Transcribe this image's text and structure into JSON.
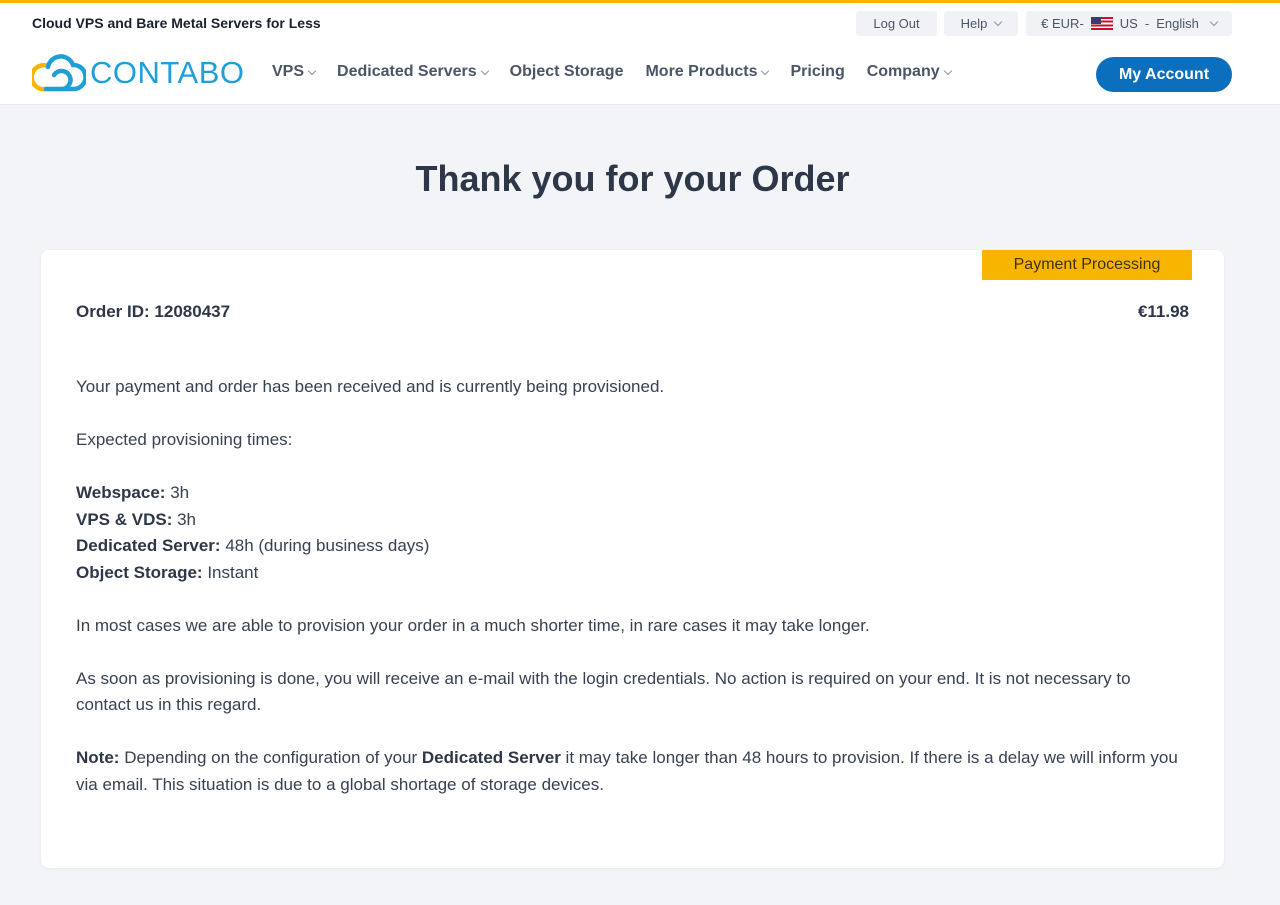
{
  "header": {
    "tagline": "Cloud VPS and Bare Metal Servers for Less",
    "logout": "Log Out",
    "help": "Help",
    "currency": "€ EUR-",
    "country": "US",
    "locale_sep": "-",
    "language": "English",
    "logo_text": "CONTABO",
    "my_account": "My Account",
    "accent_color": "#0c6fbe",
    "brand_color": "#1e9fd8",
    "highlight_color": "#f7b500"
  },
  "nav": {
    "items": [
      {
        "label": "VPS",
        "dropdown": true
      },
      {
        "label": "Dedicated Servers",
        "dropdown": true
      },
      {
        "label": "Object Storage",
        "dropdown": false
      },
      {
        "label": "More Products",
        "dropdown": true
      },
      {
        "label": "Pricing",
        "dropdown": false
      },
      {
        "label": "Company",
        "dropdown": true
      }
    ]
  },
  "page": {
    "title": "Thank you for your Order"
  },
  "order": {
    "status": "Payment Processing",
    "id_label": "Order ID:",
    "id": "12080437",
    "total": "€11.98",
    "received_text": "Your payment and order has been received and is currently being provisioned.",
    "expected_heading": "Expected provisioning times:",
    "times": [
      {
        "label": "Webspace:",
        "value": "3h"
      },
      {
        "label": "VPS & VDS:",
        "value": "3h"
      },
      {
        "label": "Dedicated Server:",
        "value": "48h (during business days)"
      },
      {
        "label": "Object Storage:",
        "value": "Instant"
      }
    ],
    "most_cases_text": "In most cases we are able to provision your order in a much shorter time, in rare cases it may take longer.",
    "email_text": "As soon as provisioning is done, you will receive an e-mail with the login credentials. No action is required on your end. It is not necessary to contact us in this regard.",
    "note_label": "Note:",
    "note_pre": "Depending on the configuration of your",
    "note_bold": "Dedicated Server",
    "note_post": "it may take longer than 48 hours to provision. If there is a delay we will inform you via email. This situation is due to a global shortage of storage devices."
  }
}
